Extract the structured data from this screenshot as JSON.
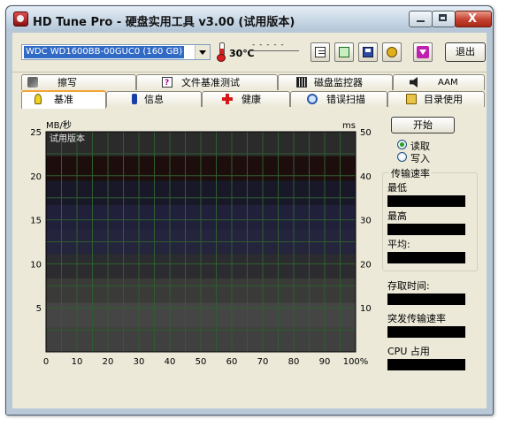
{
  "window": {
    "title": "HD Tune Pro - 硬盘实用工具 v3.00 (试用版本)",
    "close_glyph": "X"
  },
  "toolbar": {
    "drive": "WDC WD1600BB-00GUC0 (160 GB)",
    "temperature": "30℃",
    "temp_indicator": "- - - - -",
    "exit_label": "退出",
    "buttons": [
      "copy-text-icon",
      "copy-screenshot-icon",
      "save-icon",
      "options-icon",
      "download-icon"
    ]
  },
  "tabs_back": [
    {
      "label": "擦写",
      "icon": "wrench-icon"
    },
    {
      "label": "文件基准测试",
      "icon": "file-benchmark-icon"
    },
    {
      "label": "磁盘监控器",
      "icon": "monitor-icon"
    },
    {
      "label": "AAM",
      "icon": "speaker-icon"
    }
  ],
  "tabs_front": [
    {
      "label": "基准",
      "icon": "bulb-icon",
      "active": true
    },
    {
      "label": "信息",
      "icon": "info-icon"
    },
    {
      "label": "健康",
      "icon": "health-cross-icon"
    },
    {
      "label": "错误扫描",
      "icon": "magnifier-icon"
    },
    {
      "label": "目录使用",
      "icon": "folder-icon"
    }
  ],
  "side": {
    "start_label": "开始",
    "read_label": "读取",
    "write_label": "写入",
    "read_selected": true,
    "transfer_group": "传输速率",
    "min_label": "最低",
    "max_label": "最高",
    "avg_label": "平均:",
    "access_label": "存取时间:",
    "burst_label": "突发传输速率",
    "cpu_label": "CPU 占用"
  },
  "colors": {
    "bands": [
      "#2b2b2b",
      "#1d0d0d",
      "#181828",
      "#20203a",
      "#24243c",
      "#2c2c30",
      "#3a3a38",
      "#454545",
      "#404040"
    ],
    "grid": "#2e5e2e"
  },
  "chart_data": {
    "type": "line",
    "watermark": "试用版本",
    "y_left_unit": "MB/秒",
    "y_right_unit": "ms",
    "y_left_ticks": [
      "25",
      "20",
      "15",
      "10",
      "5"
    ],
    "y_right_ticks": [
      "50",
      "40",
      "30",
      "20",
      "10"
    ],
    "x_ticks": [
      "0",
      "10",
      "20",
      "30",
      "40",
      "50",
      "60",
      "70",
      "80",
      "90",
      "100%"
    ],
    "ylim_left": [
      0,
      25
    ],
    "ylim_right": [
      0,
      50
    ],
    "xlim": [
      0,
      100
    ],
    "series": [],
    "grid": true
  }
}
